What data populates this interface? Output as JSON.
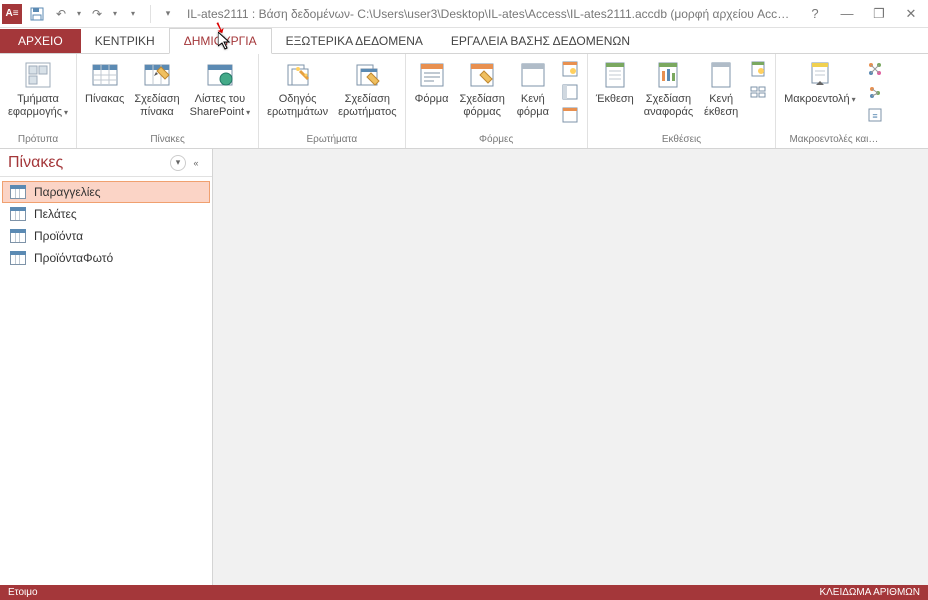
{
  "title": "IL-ates2111 : Βάση δεδομένων- C:\\Users\\user3\\Desktop\\IL-ates\\Access\\IL-ates2111.accdb (μορφή αρχείου Access 200…",
  "tabs": {
    "file": "ΑΡΧΕΙΟ",
    "home": "ΚΕΝΤΡΙΚΗ",
    "create": "ΔΗΜΙΟΥΡΓΙΑ",
    "external": "ΕΞΩΤΕΡΙΚΑ ΔΕΔΟΜΕΝΑ",
    "dbtools": "ΕΡΓΑΛΕΙΑ ΒΑΣΗΣ ΔΕΔΟΜΕΝΩΝ"
  },
  "ribbon": {
    "templates": {
      "appparts": "Τμήματα\nεφαρμογής",
      "label": "Πρότυπα"
    },
    "tables": {
      "table": "Πίνακας",
      "design": "Σχεδίαση\nπίνακα",
      "sharepoint": "Λίστες του\nSharePoint",
      "label": "Πίνακες"
    },
    "queries": {
      "wizard": "Οδηγός\nερωτημάτων",
      "design": "Σχεδίαση\nερωτήματος",
      "label": "Ερωτήματα"
    },
    "forms": {
      "form": "Φόρμα",
      "design": "Σχεδίαση\nφόρμας",
      "blank": "Κενή\nφόρμα",
      "label": "Φόρμες"
    },
    "reports": {
      "report": "Έκθεση",
      "design": "Σχεδίαση\nαναφοράς",
      "blank": "Κενή\nέκθεση",
      "label": "Εκθέσεις"
    },
    "macros": {
      "macro": "Μακροεντολή",
      "label": "Μακροεντολές και…"
    }
  },
  "nav": {
    "header": "Πίνακες",
    "items": [
      "Παραγγελίες",
      "Πελάτες",
      "Προϊόντα",
      "ΠροϊόνταΦωτό"
    ]
  },
  "status": {
    "ready": "Ετοιμο",
    "numlock": "ΚΛΕΙΔΩΜΑ ΑΡΙΘΜΩΝ"
  }
}
